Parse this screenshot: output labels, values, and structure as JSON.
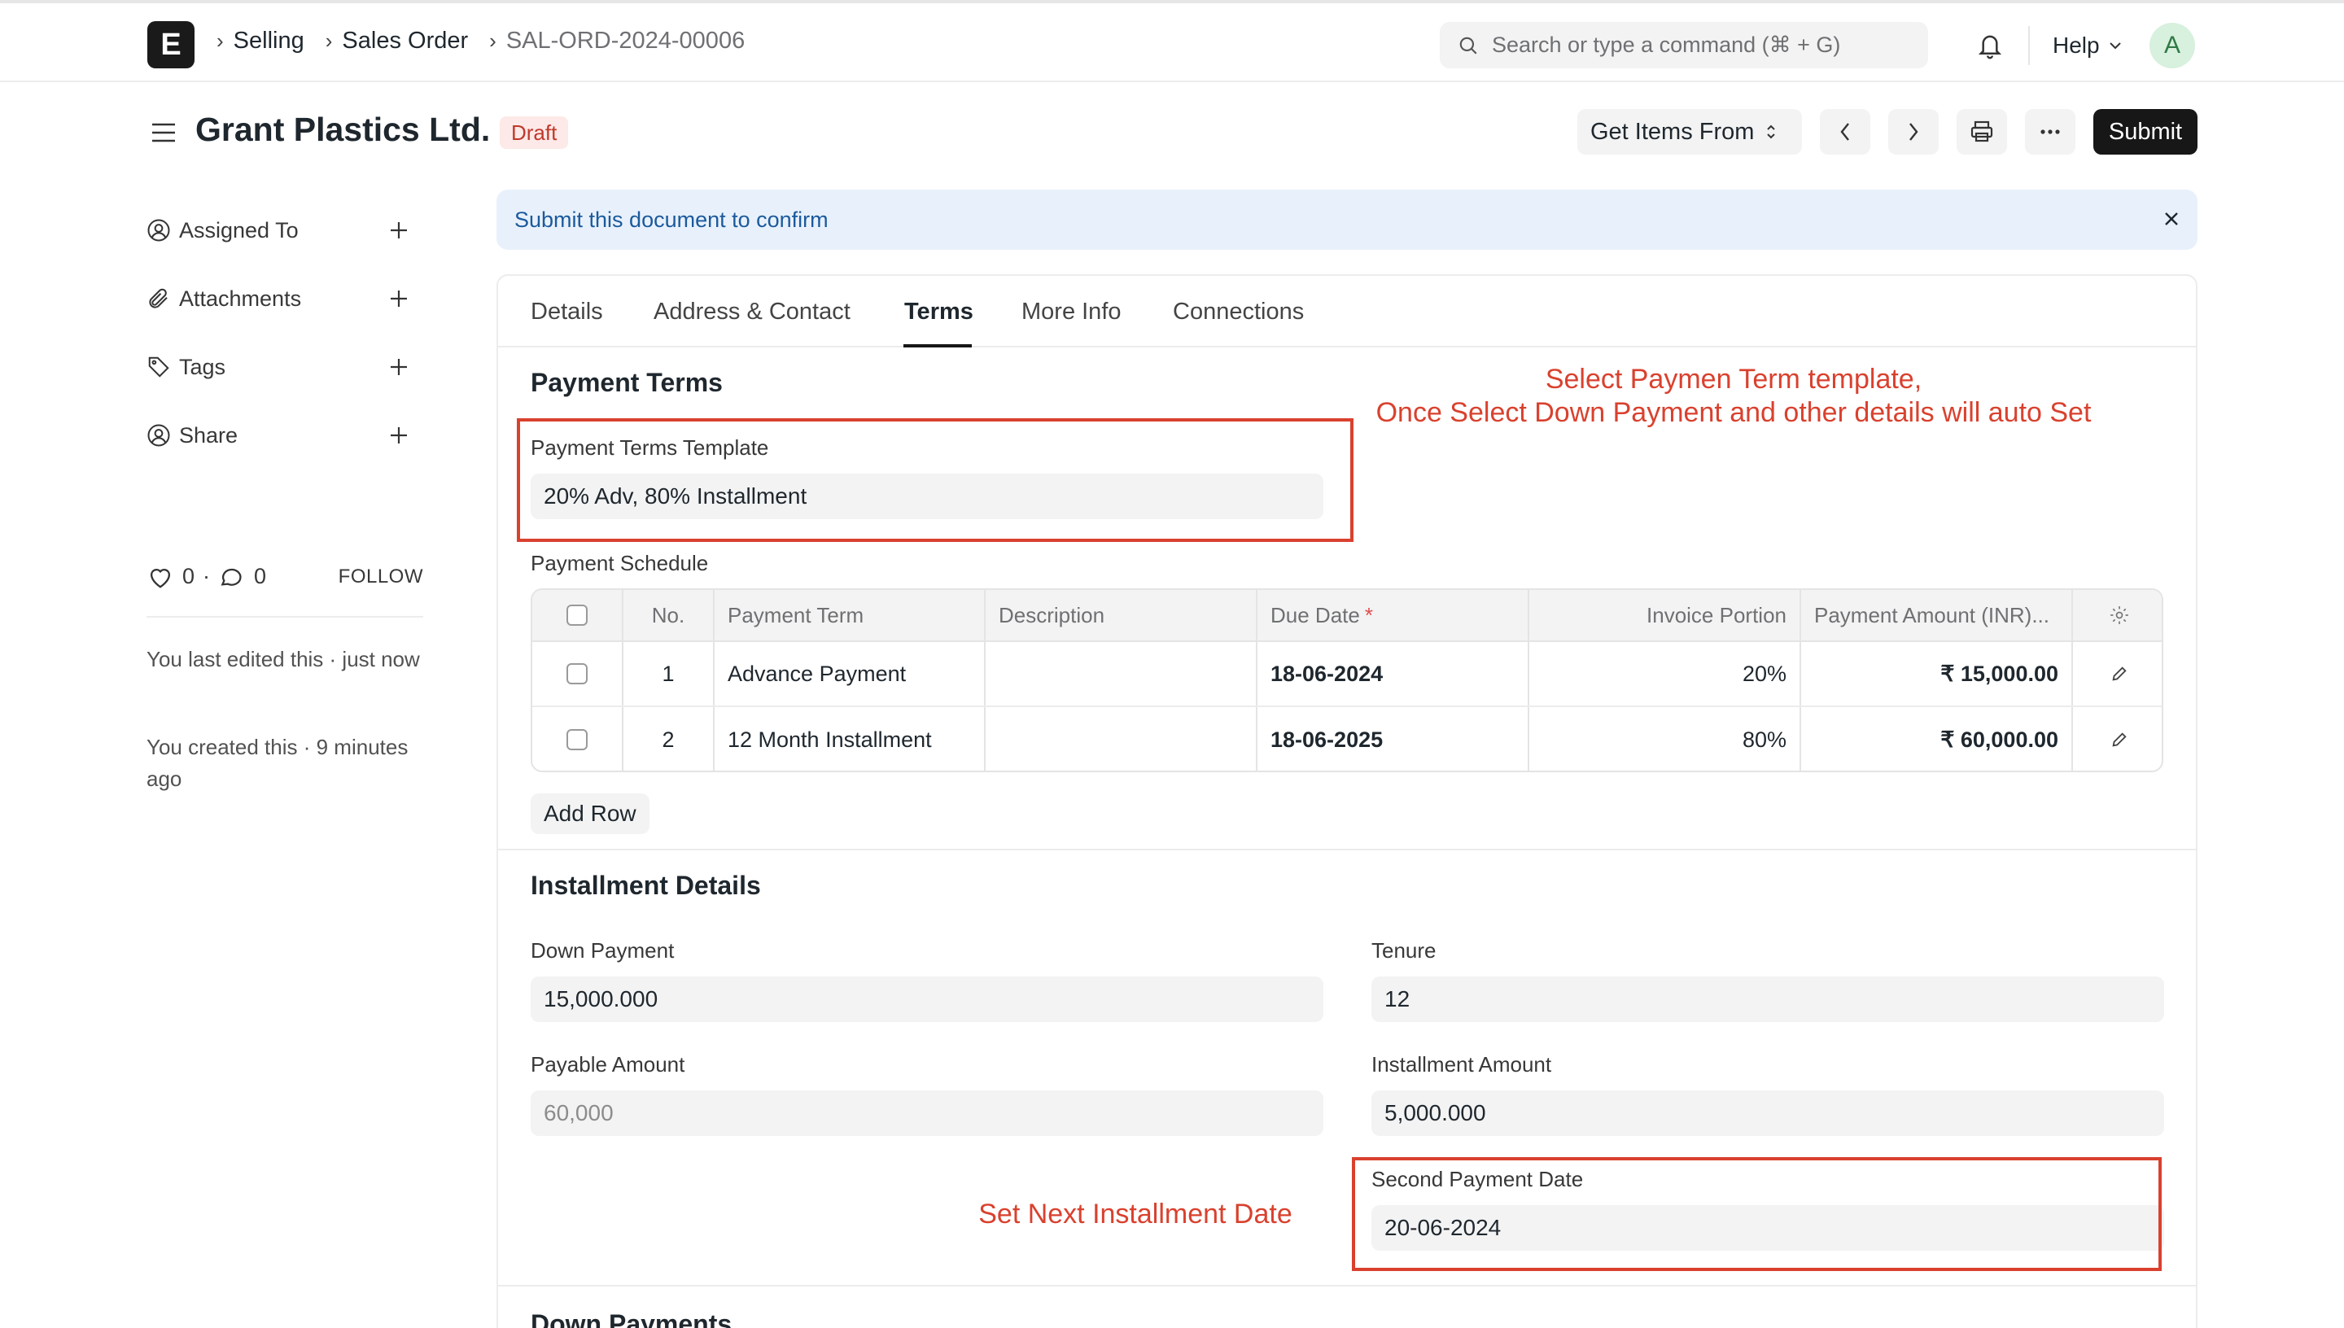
{
  "navbar": {
    "logo_letter": "E",
    "breadcrumbs": [
      "Selling",
      "Sales Order",
      "SAL-ORD-2024-00006"
    ],
    "search_placeholder": "Search or type a command (⌘ + G)",
    "help_label": "Help",
    "avatar_initial": "A"
  },
  "page": {
    "title": "Grant Plastics Ltd.",
    "status": "Draft",
    "get_items_label": "Get Items From",
    "submit_label": "Submit"
  },
  "sidebar": {
    "items": [
      {
        "label": "Assigned To",
        "icon": "assign-user-icon"
      },
      {
        "label": "Attachments",
        "icon": "paperclip-icon"
      },
      {
        "label": "Tags",
        "icon": "tag-icon"
      },
      {
        "label": "Share",
        "icon": "share-user-icon"
      }
    ],
    "likes_count": "0",
    "comments_count": "0",
    "separator": "·",
    "follow_label": "FOLLOW",
    "last_edited": "You last edited this · just now",
    "created": "You created this · 9 minutes ago"
  },
  "alert": {
    "text": "Submit this document to confirm"
  },
  "tabs": [
    "Details",
    "Address & Contact",
    "Terms",
    "More Info",
    "Connections"
  ],
  "active_tab": "Terms",
  "payment_terms": {
    "section_title": "Payment Terms",
    "template_label": "Payment Terms Template",
    "template_value": "20% Adv, 80% Installment",
    "schedule_label": "Payment Schedule",
    "columns": [
      "No.",
      "Payment Term",
      "Description",
      "Due Date",
      "Invoice Portion",
      "Payment Amount (INR)..."
    ],
    "rows": [
      {
        "no": "1",
        "term": "Advance Payment",
        "description": "",
        "due_date": "18-06-2024",
        "portion": "20%",
        "amount": "₹ 15,000.00"
      },
      {
        "no": "2",
        "term": "12 Month Installment",
        "description": "",
        "due_date": "18-06-2025",
        "portion": "80%",
        "amount": "₹ 60,000.00"
      }
    ],
    "add_row_label": "Add Row"
  },
  "installment": {
    "section_title": "Installment Details",
    "down_payment_label": "Down Payment",
    "down_payment_value": "15,000.000",
    "tenure_label": "Tenure",
    "tenure_value": "12",
    "payable_label": "Payable Amount",
    "payable_value": "60,000",
    "installment_amount_label": "Installment Amount",
    "installment_amount_value": "5,000.000",
    "second_date_label": "Second Payment Date",
    "second_date_value": "20-06-2024"
  },
  "down_payments": {
    "section_title": "Down Payments"
  },
  "annotations": {
    "template_note_line1": "Select Paymen Term template,",
    "template_note_line2": "Once Select Down Payment and other details will auto Set",
    "date_note": "Set Next Installment Date",
    "color": "#d9412e"
  }
}
